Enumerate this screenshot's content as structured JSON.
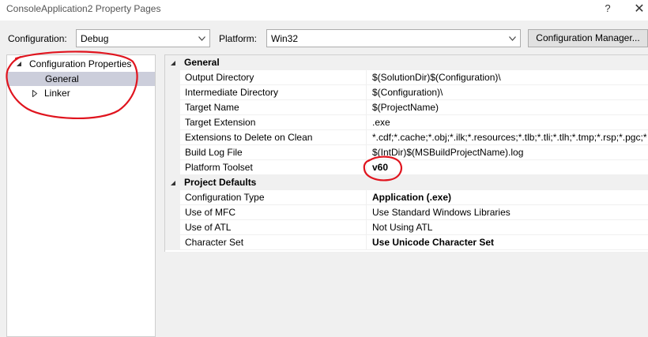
{
  "window": {
    "title": "ConsoleApplication2 Property Pages",
    "help_glyph": "?",
    "close_glyph": "✕"
  },
  "toolbar": {
    "configuration_label": "Configuration:",
    "configuration_value": "Debug",
    "platform_label": "Platform:",
    "platform_value": "Win32",
    "config_manager_label": "Configuration Manager..."
  },
  "tree": {
    "root": {
      "label": "Configuration Properties",
      "expanded": true
    },
    "items": [
      {
        "label": "General",
        "selected": true
      },
      {
        "label": "Linker",
        "expanded": false
      }
    ]
  },
  "grid": {
    "categories": [
      {
        "label": "General",
        "rows": [
          {
            "name": "Output Directory",
            "value": "$(SolutionDir)$(Configuration)\\",
            "bold": false
          },
          {
            "name": "Intermediate Directory",
            "value": "$(Configuration)\\",
            "bold": false
          },
          {
            "name": "Target Name",
            "value": "$(ProjectName)",
            "bold": false
          },
          {
            "name": "Target Extension",
            "value": ".exe",
            "bold": false
          },
          {
            "name": "Extensions to Delete on Clean",
            "value": "*.cdf;*.cache;*.obj;*.ilk;*.resources;*.tlb;*.tli;*.tlh;*.tmp;*.rsp;*.pgc;*",
            "bold": false
          },
          {
            "name": "Build Log File",
            "value": "$(IntDir)$(MSBuildProjectName).log",
            "bold": false
          },
          {
            "name": "Platform Toolset",
            "value": "v60",
            "bold": true
          }
        ]
      },
      {
        "label": "Project Defaults",
        "rows": [
          {
            "name": "Configuration Type",
            "value": "Application (.exe)",
            "bold": true
          },
          {
            "name": "Use of MFC",
            "value": "Use Standard Windows Libraries",
            "bold": false
          },
          {
            "name": "Use of ATL",
            "value": "Not Using ATL",
            "bold": false
          },
          {
            "name": "Character Set",
            "value": "Use Unicode Character Set",
            "bold": true
          }
        ]
      }
    ]
  },
  "colors": {
    "annotation": "#e0141e",
    "selection": "#cccedb",
    "window_bg": "#f0f0f0"
  }
}
